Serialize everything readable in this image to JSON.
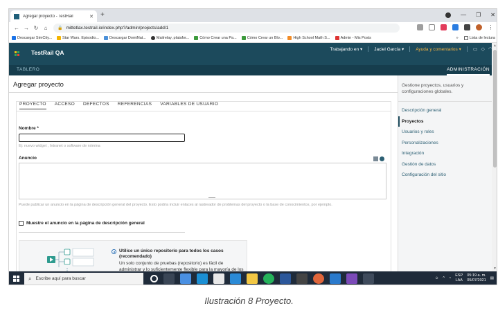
{
  "browser": {
    "tab_title": "Agregar proyecto - TestRail",
    "url": "mittetlax.testrail.io/index.php?/admin/projects/add/1",
    "bookmarks": [
      "Descargar SimCity...",
      "Star Wars. Episodio...",
      "Descargar DomiNat...",
      "Mailrelay, platafor...",
      "Cómo Crear una Pa...",
      "Cómo Crear un Blo...",
      "High School Math S...",
      "Admin - Mis Posts"
    ],
    "reading_list": "Lista de lectura",
    "more_bookmarks": "»"
  },
  "app": {
    "name": "TestRail QA",
    "menu": {
      "working_in": "Trabajando en ▾",
      "user": "Jaciel García ▾",
      "help": "Ayuda y comentarios ▾"
    },
    "nav_left": "TABLERO",
    "nav_right": "ADMINISTRACIÓN"
  },
  "page": {
    "title": "Agregar proyecto",
    "tabs": [
      "PROYECTO",
      "ACCESO",
      "DEFECTOS",
      "REFERENCIAS",
      "VARIABLES DE USUARIO"
    ],
    "name_label": "Nombre *",
    "name_value": "",
    "name_hint": "Ej: nuevo widget , Intranet o software de nómina",
    "announcement_label": "Anuncio",
    "announcement_value": "",
    "announcement_hint": "Puede publicar un anuncio en la página de descripción general del proyecto. Esto podría incluir enlaces al rastreador de problemas del proyecto o la base de conocimientos, por ejemplo.",
    "show_announcement_label": "Muestre el anuncio en la página de descripción general",
    "repo_option_title": "Utilice un único repositorio para todos los casos (recomendado)",
    "repo_option_desc": "Un solo conjunto de pruebas (repositorio) es fácil de administrar y lo suficientemente flexible para la mayoría de los proyectos con pocas o ninguna versión simultánea"
  },
  "sidebar": {
    "description": "Gestione proyectos, usuarios y configuraciones globales.",
    "items": [
      "Descripción general",
      "Proyectos",
      "Usuarios y roles",
      "Personalizaciones",
      "Integración",
      "Gestión de datos",
      "Configuración del sitio"
    ],
    "active_index": 1
  },
  "taskbar": {
    "search_placeholder": "Escribe aquí para buscar",
    "lang_top": "ESP",
    "lang_bottom": "LAA",
    "time": "05:19 a. m.",
    "date": "05/07/2021"
  },
  "caption": "Ilustración 8 Proyecto.",
  "colors": {
    "header": "#1c4a5c",
    "accent_help": "#f5b342",
    "link": "#2c5f73",
    "taskbar": "#1f2b3a"
  }
}
